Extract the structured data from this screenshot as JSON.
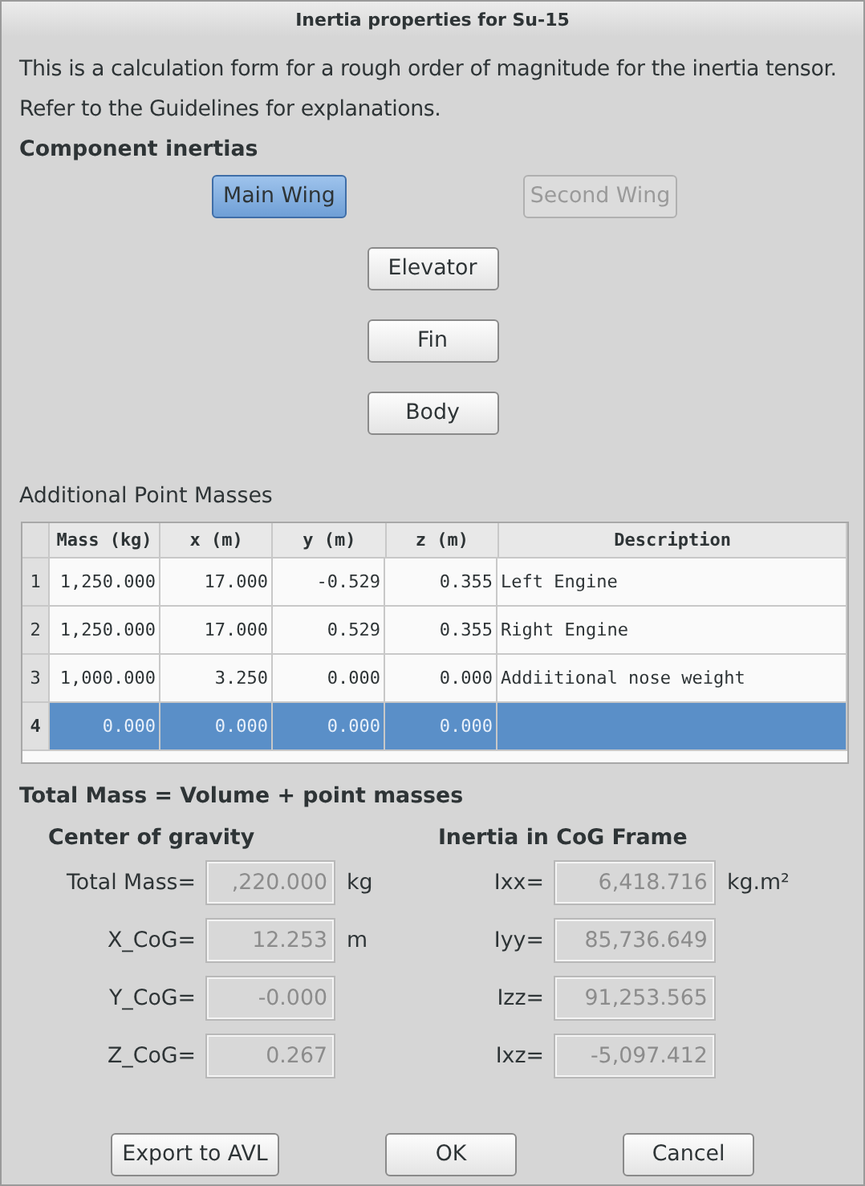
{
  "window": {
    "title": "Inertia properties for Su-15"
  },
  "intro": [
    "This is a calculation form for a rough order of magnitude for the inertia tensor.",
    "Refer to the Guidelines for explanations."
  ],
  "component_heading": "Component inertias",
  "component_buttons": [
    {
      "label": "Main Wing",
      "selected": true,
      "disabled": false
    },
    {
      "label": "Second Wing",
      "selected": false,
      "disabled": true
    },
    {
      "label": "Elevator",
      "selected": false,
      "disabled": false
    },
    {
      "label": "Fin",
      "selected": false,
      "disabled": false
    },
    {
      "label": "Body",
      "selected": false,
      "disabled": false
    }
  ],
  "point_masses": {
    "heading": "Additional Point Masses",
    "columns": [
      "Mass (kg)",
      "x (m)",
      "y (m)",
      "z (m)",
      "Description"
    ],
    "rows": [
      {
        "number": "1",
        "cells": [
          "1,250.000",
          "17.000",
          "-0.529",
          "0.355",
          "Left Engine"
        ],
        "selected": false
      },
      {
        "number": "2",
        "cells": [
          "1,250.000",
          "17.000",
          "0.529",
          "0.355",
          "Right Engine"
        ],
        "selected": false
      },
      {
        "number": "3",
        "cells": [
          "1,000.000",
          "3.250",
          "0.000",
          "0.000",
          "Addiitional nose weight"
        ],
        "selected": false
      },
      {
        "number": "4",
        "cells": [
          "0.000",
          "0.000",
          "0.000",
          "0.000"
        ],
        "selected": true
      }
    ]
  },
  "totals_heading": "Total Mass = Volume + point masses",
  "cog": {
    "heading": "Center of gravity",
    "fields": [
      {
        "label": "Total Mass=",
        "value": ",220.000",
        "unit": "kg",
        "disabled": true
      },
      {
        "label": "X_CoG=",
        "value": "12.253",
        "unit": "m",
        "disabled": true
      },
      {
        "label": "Y_CoG=",
        "value": "-0.000",
        "disabled": true
      },
      {
        "label": "Z_CoG=",
        "value": "0.267",
        "disabled": true
      }
    ]
  },
  "inertia": {
    "heading": "Inertia in CoG Frame",
    "fields": [
      {
        "label": "Ixx=",
        "value": "6,418.716",
        "unit": "kg.m²",
        "disabled": true
      },
      {
        "label": "Iyy=",
        "value": "85,736.649",
        "disabled": true
      },
      {
        "label": "Izz=",
        "value": "91,253.565",
        "disabled": true
      },
      {
        "label": "Ixz=",
        "value": "-5,097.412",
        "disabled": true
      }
    ]
  },
  "buttons": [
    "Export to AVL",
    "OK",
    "Cancel"
  ]
}
